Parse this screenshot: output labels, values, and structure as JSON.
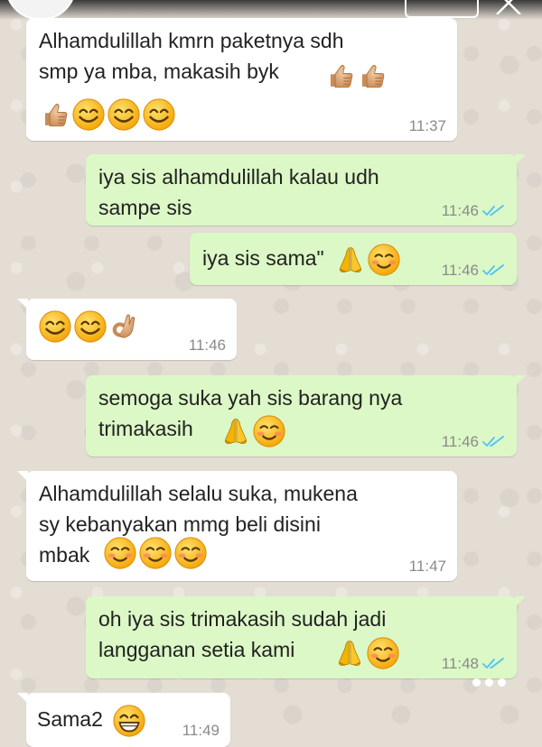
{
  "header": {
    "title": "",
    "button_label": ""
  },
  "messages": [
    {
      "id": "m1",
      "dir": "in",
      "text": "Alhamdulillah kmrn paketnya sdh\nsmp ya mba, makasih byk",
      "time": "11:37"
    },
    {
      "id": "m2",
      "dir": "out",
      "text": "iya sis alhamdulillah kalau udh\nsampe sis",
      "time": "11:46"
    },
    {
      "id": "m3",
      "dir": "out",
      "text": "iya sis sama\"",
      "time": "11:46"
    },
    {
      "id": "m4",
      "dir": "in",
      "text": "",
      "time": "11:46"
    },
    {
      "id": "m5",
      "dir": "out",
      "text": "semoga suka yah sis barang nya\ntrimakasih",
      "time": "11:46"
    },
    {
      "id": "m6",
      "dir": "in",
      "text": "Alhamdulillah selalu suka, mukena\nsy kebanyakan mmg beli disini\nmbak",
      "time": "11:47"
    },
    {
      "id": "m7",
      "dir": "out",
      "text": "oh iya sis trimakasih sudah jadi\nlangganan setia kami",
      "time": "11:48"
    },
    {
      "id": "m8",
      "dir": "in",
      "text": "Sama2",
      "time": "11:49"
    }
  ],
  "icons": {
    "thumbs_up": "thumbs-up-icon",
    "smile": "smile-icon",
    "pray": "pray-icon",
    "blush": "blush-icon",
    "ok_hand": "ok-hand-icon",
    "grin": "grin-icon",
    "read_ticks": "double-check-icon",
    "close": "close-icon",
    "more": "more-dots-icon"
  },
  "colors": {
    "incoming": "#ffffff",
    "outgoing": "#dcf8c6",
    "read_tick": "#4fc3f7",
    "background": "#e5ddd5"
  }
}
